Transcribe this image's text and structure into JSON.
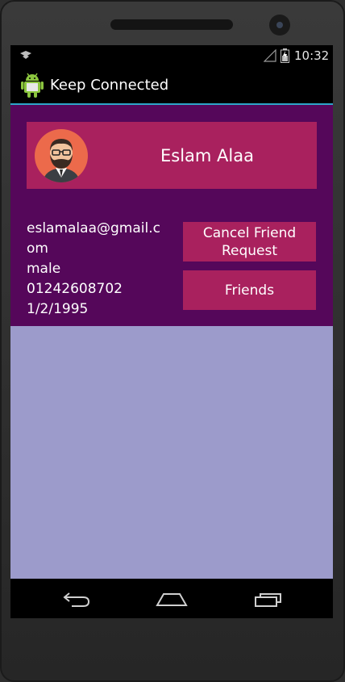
{
  "status_bar": {
    "time": "10:32",
    "left_icon": "notification-icon",
    "signal_icon": "signal-icon",
    "battery_icon": "battery-icon"
  },
  "app_bar": {
    "title": "Keep Connected",
    "icon": "android-icon"
  },
  "profile": {
    "name": "Eslam Alaa",
    "avatar": "avatar-man-glasses-beard",
    "email": "eslamalaa@gmail.com",
    "gender": "male",
    "phone": "01242608702",
    "birthdate": "1/2/1995"
  },
  "actions": {
    "cancel_request_label": "Cancel Friend Request",
    "friends_label": "Friends"
  },
  "colors": {
    "panel": "#55075a",
    "accent": "#a9215e",
    "background": "#9c9bcb",
    "divider": "#2ea6c9"
  },
  "nav_bar": {
    "back_icon": "back-icon",
    "home_icon": "home-icon",
    "recents_icon": "recents-icon"
  }
}
